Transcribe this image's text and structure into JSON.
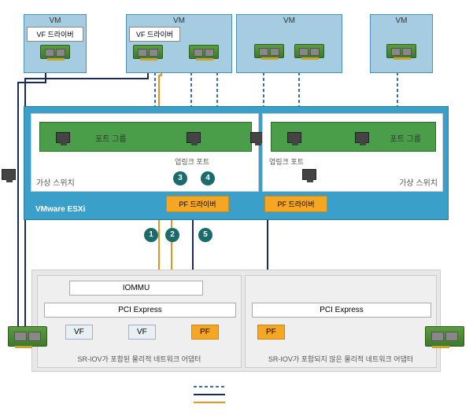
{
  "vm_label": "VM",
  "vf_driver_label": "VF 드라이버",
  "esxi_label": "VMware ESXi",
  "vswitch_label": "가상 스위치",
  "portgroup_label": "포트 그룹",
  "uplink_label": "업링크 포트",
  "pf_driver_label": "PF 드라이버",
  "iommu_label": "IOMMU",
  "pcie_label": "PCI Express",
  "vf_label": "VF",
  "pf_label": "PF",
  "phys_sriov_label": "SR-IOV가 포함된 물리적 네트워크 어댑터",
  "phys_nosriov_label": "SR-IOV가 포함되지 않은 물리적 네트워크 어댑터",
  "numbers": {
    "n1": "1",
    "n2": "2",
    "n3": "3",
    "n4": "4",
    "n5": "5"
  },
  "diagram_semantics": {
    "vms": [
      {
        "has_vf_driver": true,
        "nics": 1
      },
      {
        "has_vf_driver": true,
        "nics": 2
      },
      {
        "has_vf_driver": false,
        "nics": 2
      },
      {
        "has_vf_driver": false,
        "nics": 1
      }
    ],
    "esxi": {
      "vswitches": [
        {
          "port_group_ports": 3,
          "uplink_ports": 1,
          "pf_driver": true
        },
        {
          "port_group_ports": 2,
          "uplink_ports": 1,
          "pf_driver": true
        }
      ]
    },
    "physical_adapters": [
      {
        "sriov": true,
        "iommu": true,
        "pcie": true,
        "vf_count": 2,
        "pf": true
      },
      {
        "sriov": false,
        "iommu": false,
        "pcie": true,
        "vf_count": 0,
        "pf": true
      }
    ],
    "legend_line_styles": [
      "dashed-blue",
      "solid-navy",
      "solid-orange"
    ]
  }
}
